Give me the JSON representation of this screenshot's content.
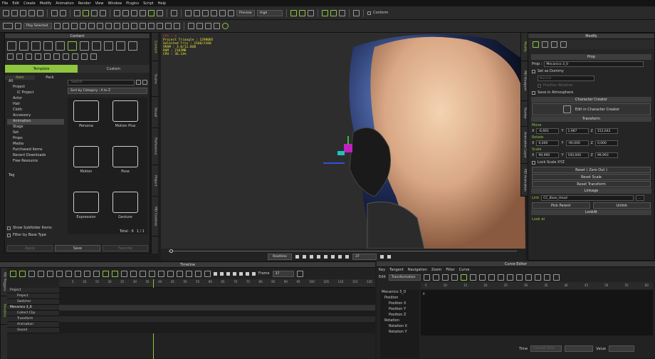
{
  "menu": [
    "File",
    "Edit",
    "Create",
    "Modify",
    "Animation",
    "Render",
    "View",
    "Window",
    "Plugins",
    "Script",
    "Help"
  ],
  "toolbar": {
    "preview_select": "Preview",
    "quality_select": "High",
    "conform_label": "Conform",
    "play_select": "Play Selected"
  },
  "content": {
    "title": "Content",
    "tabs": [
      "Template",
      "Custom"
    ],
    "subtabs": [
      "Item",
      "Pack"
    ],
    "search_placeholder": "Search",
    "sort_label": "Sort by Category : A to Z",
    "tree": [
      "All",
      "Project",
      "iC Project",
      "Actor",
      "Hair",
      "Cloth",
      "Accessory",
      "Animation",
      "Stage",
      "Set",
      "Props",
      "Media",
      "Purchased Items",
      "Recent Downloads",
      "Free Resource"
    ],
    "tag_label": "Tag",
    "folders": [
      "Persona",
      "Motion Plus",
      "Motion",
      "Pose",
      "Expression",
      "Gesture"
    ],
    "total": "Total : 6",
    "page": "1 / 1",
    "show_subfolder": "Show Subfolder Items",
    "filter_base": "Filter by Base Type",
    "buttons": [
      "Apply",
      "Save",
      "Favorite"
    ],
    "vtabs": [
      "Content",
      "Scene",
      "Visual",
      "Preference",
      "Project",
      "MD Controls"
    ]
  },
  "stats": [
    "FPS : 4",
    "Project Triangle : 1298005",
    "Selected Tris : 2160/2160",
    "VRAM : 3.0/11.0GB",
    "RAM : 2163MB",
    "CPU : 36.14%"
  ],
  "viewport": {
    "realtime": "Realtime",
    "frame": "37"
  },
  "modify": {
    "title": "Modify",
    "vtabs": [
      "Modify",
      "Mtl Viewport",
      "Render",
      "Animation Layer",
      "MD Animation"
    ],
    "prop_section": "Prop",
    "prop_label": "Prop :",
    "prop_name": "Mecanico 3_0",
    "set_dummy": "Set as Dummy",
    "normal": "Normal",
    "position_relative": "Position Relative",
    "save_atmosphere": "Save in Atmosphere",
    "character_creator": "Character Creator",
    "edit_cc": "Edit in Character Creator",
    "transform": "Transform",
    "move": "Move",
    "rotate": "Rotate",
    "scale": "Scale",
    "move_vals": [
      "-6,661",
      "1,987",
      "152,642"
    ],
    "rotate_vals": [
      "0,000",
      "-90,000",
      "0,000"
    ],
    "scale_vals": [
      "99,990",
      "100,000",
      "99,993"
    ],
    "lock_scale": "Lock Scale XYZ",
    "reset_zero": "Reset ( Zero Out )",
    "reset_scale": "Reset Scale",
    "reset_transform": "Reset Transform",
    "linkage": "Linkage",
    "link_label": "Link",
    "link_value": "CC_Base_Head",
    "pick_parent": "Pick Parent",
    "unlink": "Unlink",
    "lookat": "LookAt",
    "lookat_label": "Look at"
  },
  "timeline": {
    "title": "Timeline",
    "frame_label": "Frame",
    "frame": "37",
    "vtabs": [
      "MD Triggers",
      "Timeline"
    ],
    "ruler": [
      "5",
      "10",
      "15",
      "20",
      "25",
      "30",
      "35",
      "40",
      "45",
      "50",
      "55",
      "60",
      "65",
      "70",
      "75",
      "80",
      "85",
      "90",
      "95",
      "100",
      "105",
      "110",
      "115",
      "120"
    ],
    "tracks": [
      "Project",
      "Project",
      "Switcher",
      "Mecanico 3_0",
      "Collect Clip",
      "Transform",
      "Animation",
      "Sound"
    ]
  },
  "curve": {
    "title": "Curve Editor",
    "menu": [
      "Key",
      "Tangent",
      "Navigation",
      "Zoom",
      "Filter",
      "Curve"
    ],
    "edit_label": "Edit",
    "mode": "Transformation",
    "tree": [
      "Mecanico 3_0",
      "Position",
      "Position X",
      "Position Y",
      "Position Z",
      "Rotation",
      "Rotation X",
      "Rotation Y"
    ],
    "axis_zero": "0",
    "ruler": [
      "5",
      "10",
      "15",
      "20",
      "25",
      "30",
      "35",
      "40",
      "45",
      "50",
      "55",
      "60"
    ],
    "time_label": "Time",
    "current_time": "Current Time",
    "value_label": "Value"
  },
  "colors": {
    "accent": "#8ec63f",
    "panel": "#252525",
    "skin": "#d9a784"
  }
}
